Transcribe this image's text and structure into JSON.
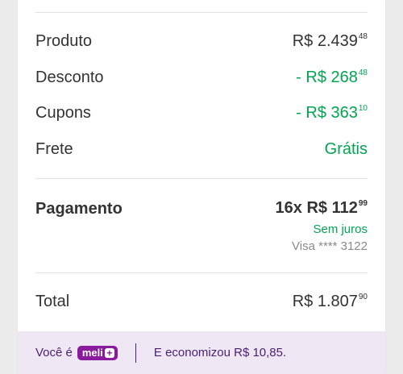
{
  "summary": {
    "produto": {
      "label": "Produto",
      "value": "R$ 2.439",
      "cents": "48"
    },
    "desconto": {
      "label": "Desconto",
      "value": "- R$ 268",
      "cents": "48"
    },
    "cupons": {
      "label": "Cupons",
      "value": "- R$ 363",
      "cents": "10"
    },
    "frete": {
      "label": "Frete",
      "value": "Grátis"
    }
  },
  "payment": {
    "label": "Pagamento",
    "installments": "16x R$ 112",
    "cents": "99",
    "interest_note": "Sem juros",
    "card": "Visa **** 3122"
  },
  "total": {
    "label": "Total",
    "value": "R$ 1.807",
    "cents": "90"
  },
  "footer": {
    "prefix": "Você é",
    "badge": "meli",
    "badge_plus": "+",
    "savings": "E economizou R$ 10,85."
  },
  "colors": {
    "green": "#00a650",
    "purple": "#8a1b9e",
    "footer_bg": "#efe7f3"
  }
}
